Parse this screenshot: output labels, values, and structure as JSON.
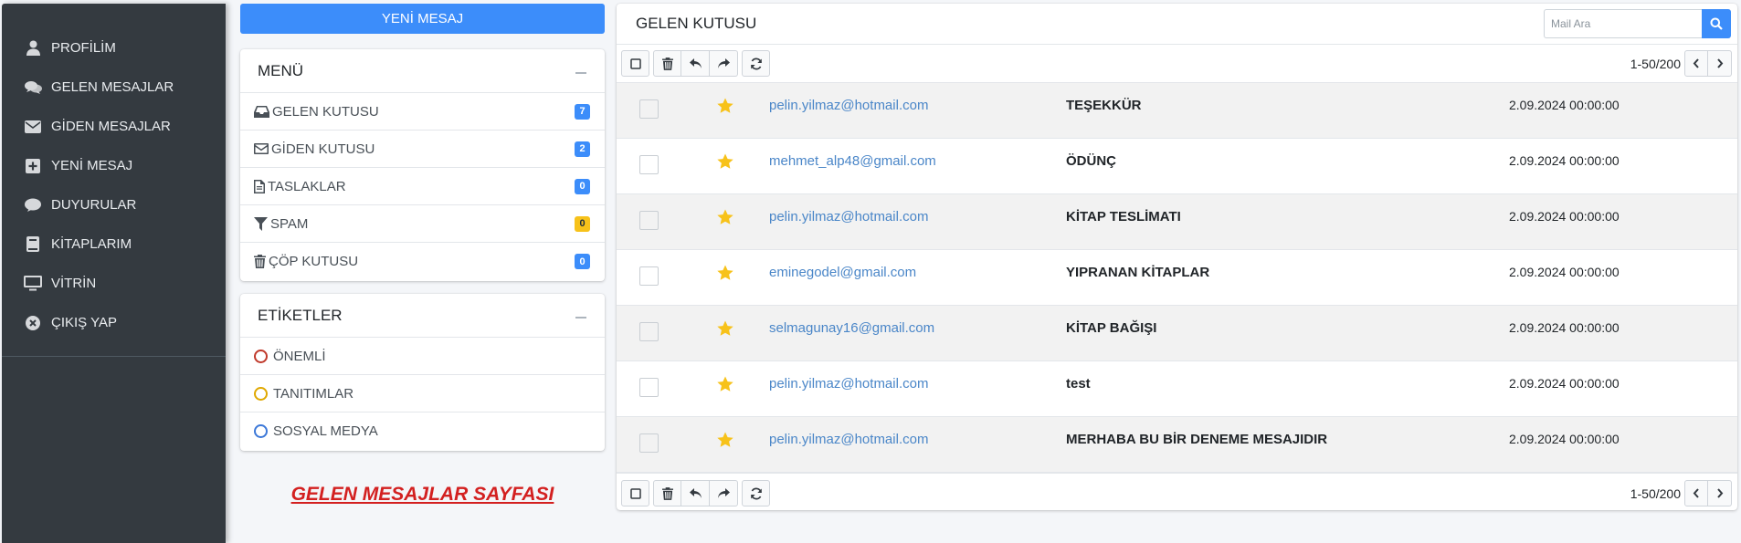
{
  "sidebar": {
    "items": [
      {
        "label": "PROFİLİM",
        "icon": "user-icon"
      },
      {
        "label": "GELEN MESAJLAR",
        "icon": "comments-icon"
      },
      {
        "label": "GİDEN MESAJLAR",
        "icon": "envelope-icon"
      },
      {
        "label": "YENİ MESAJ",
        "icon": "plus-square-icon"
      },
      {
        "label": "DUYURULAR",
        "icon": "comment-icon"
      },
      {
        "label": "KİTAPLARIM",
        "icon": "book-icon"
      },
      {
        "label": "VİTRİN",
        "icon": "desktop-icon"
      },
      {
        "label": "ÇIKIŞ YAP",
        "icon": "times-circle-icon"
      }
    ]
  },
  "compose_button": "YENİ MESAJ",
  "menu": {
    "title": "MENÜ",
    "items": [
      {
        "label": "GELEN KUTUSU",
        "count": "7",
        "icon": "inbox-icon",
        "badge_color": "#3c8dfa"
      },
      {
        "label": "GİDEN KUTUSU",
        "count": "2",
        "icon": "envelope-outline-icon",
        "badge_color": "#3c8dfa"
      },
      {
        "label": "TASLAKLAR",
        "count": "0",
        "icon": "file-icon",
        "badge_color": "#3c8dfa"
      },
      {
        "label": "SPAM",
        "count": "0",
        "icon": "filter-icon",
        "badge_color": "#f7c21a"
      },
      {
        "label": "ÇÖP KUTUSU",
        "count": "0",
        "icon": "trash-icon",
        "badge_color": "#3c8dfa"
      }
    ]
  },
  "labels": {
    "title": "ETİKETLER",
    "items": [
      {
        "label": "ÖNEMLİ",
        "color": "#c0392b"
      },
      {
        "label": "TANITIMLAR",
        "color": "#e0a800"
      },
      {
        "label": "SOSYAL MEDYA",
        "color": "#3c78d8"
      }
    ]
  },
  "page_caption": "GELEN MESAJLAR SAYFASI",
  "mailbox": {
    "title": "GELEN KUTUSU",
    "search_placeholder": "Mail Ara",
    "pagination": "1-50/200",
    "messages": [
      {
        "from": "pelin.yilmaz@hotmail.com",
        "subject": "TEŞEKKÜR",
        "date": "2.09.2024 00:00:00",
        "starred": true
      },
      {
        "from": "mehmet_alp48@gmail.com",
        "subject": "ÖDÜNÇ",
        "date": "2.09.2024 00:00:00",
        "starred": true
      },
      {
        "from": "pelin.yilmaz@hotmail.com",
        "subject": "KİTAP TESLİMATI",
        "date": "2.09.2024 00:00:00",
        "starred": true
      },
      {
        "from": "eminegodel@gmail.com",
        "subject": "YIPRANAN KİTAPLAR",
        "date": "2.09.2024 00:00:00",
        "starred": true
      },
      {
        "from": "selmagunay16@gmail.com",
        "subject": "KİTAP BAĞIŞI",
        "date": "2.09.2024 00:00:00",
        "starred": true
      },
      {
        "from": "pelin.yilmaz@hotmail.com",
        "subject": "test",
        "date": "2.09.2024 00:00:00",
        "starred": true
      },
      {
        "from": "pelin.yilmaz@hotmail.com",
        "subject": "MERHABA BU BİR DENEME MESAJIDIR",
        "date": "2.09.2024 00:00:00",
        "starred": true
      }
    ]
  },
  "colors": {
    "accent": "#3c8dfa",
    "sidebar": "#343a40",
    "star": "#f7c21a",
    "caption": "#d32020"
  }
}
